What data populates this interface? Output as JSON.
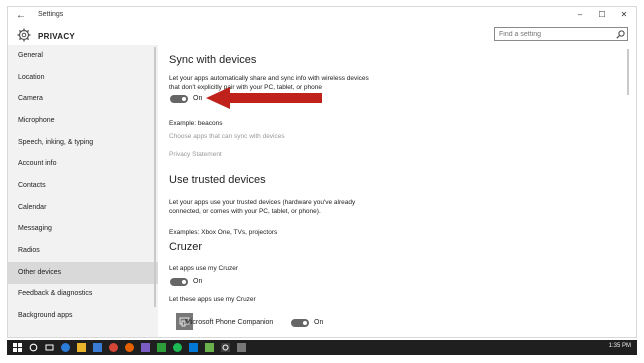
{
  "window": {
    "app_title": "Settings",
    "back_icon": "back-arrow-icon",
    "controls": {
      "minimize": "–",
      "maximize": "☐",
      "close": "✕"
    }
  },
  "header": {
    "section_title": "PRIVACY",
    "search_placeholder": "Find a setting"
  },
  "sidebar": {
    "items": [
      {
        "label": "General"
      },
      {
        "label": "Location"
      },
      {
        "label": "Camera"
      },
      {
        "label": "Microphone"
      },
      {
        "label": "Speech, inking, & typing"
      },
      {
        "label": "Account info"
      },
      {
        "label": "Contacts"
      },
      {
        "label": "Calendar"
      },
      {
        "label": "Messaging"
      },
      {
        "label": "Radios"
      },
      {
        "label": "Other devices",
        "selected": true
      },
      {
        "label": "Feedback & diagnostics"
      },
      {
        "label": "Background apps"
      }
    ]
  },
  "main": {
    "sync": {
      "heading": "Sync with devices",
      "description": "Let your apps automatically share and sync info with wireless devices that don't explicitly pair with your PC, tablet, or phone",
      "toggle_state": "On",
      "example": "Example: beacons",
      "choose_link": "Choose apps that can sync with devices",
      "privacy_link": "Privacy Statement"
    },
    "trusted": {
      "heading": "Use trusted devices",
      "description": "Let your apps use your trusted devices (hardware you've already connected, or comes with your PC, tablet, or phone).",
      "examples": "Examples: Xbox One, TVs, projectors"
    },
    "cruzer": {
      "heading": "Cruzer",
      "let_apps_label": "Let apps use my Cruzer",
      "let_apps_toggle": "On",
      "let_these_label": "Let these apps use my Cruzer",
      "app_name": "Microsoft Phone Companion",
      "app_toggle": "On"
    }
  },
  "annotation": {
    "color": "#c0221b"
  },
  "taskbar": {
    "time": "1:35 PM",
    "icons": [
      "start-icon",
      "search-icon",
      "task-view-icon",
      "edge-icon",
      "file-explorer-icon",
      "store-icon",
      "chrome-icon",
      "firefox-icon",
      "app-icon",
      "app-icon",
      "spotify-icon",
      "app-icon",
      "app-icon",
      "settings-icon",
      "app-icon"
    ]
  }
}
